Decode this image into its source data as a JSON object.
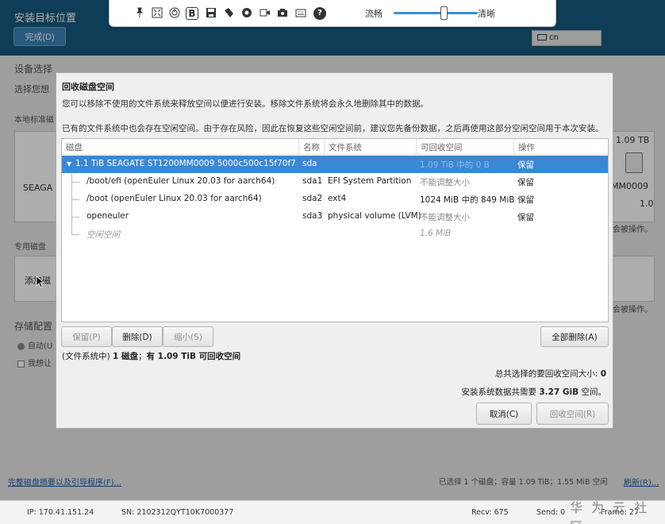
{
  "background": {
    "header_title": "安装目标位置",
    "done_button": "完成(D)",
    "keyboard_layout": "cn",
    "device_selection": "设备选择",
    "device_selection_desc": "选择您想",
    "local_disks": "本地标准磁",
    "disk_name_left": "SEAGA",
    "disk_size_right": "1.09 TB",
    "disk_model_right": "MM0009",
    "disk_num_right": "1.0",
    "not_touched": "会被操作。",
    "special_disks": "专用磁盘",
    "add_disk": "添加磁",
    "storage_config": "存储配置",
    "auto_option": "自动(U",
    "custom_option": "我想让",
    "footer_link": "完整磁盘摘要以及引导程序(F)...",
    "footer_status": "已选择 1 个磁盘；容量 1.09 TiB；1.55 MiB 空闲",
    "refresh_link": "刷新(R)..."
  },
  "toolbar": {
    "label_smooth": "流畅",
    "label_clear": "清晰",
    "quality_value": 0.6
  },
  "dialog": {
    "title": "回收磁盘空间",
    "intro": "您可以移除不使用的文件系统来释放空间以便进行安装。移除文件系统将会永久地删除其中的数据。",
    "warning": "已有的文件系统中也会存在空闲空间。由于存在风险，因此在恢复这些空闲空间前，建议您先备份数据，之后再使用这部分空闲空间用于本次安装。",
    "columns": [
      "磁盘",
      "名称",
      "文件系统",
      "可回收空间",
      "操作"
    ],
    "rows": [
      {
        "disk": "1.1 TiB SEAGATE ST1200MM0009 5000c500c15f70f7",
        "name": "sda",
        "fs": "",
        "reclaimable": "1.09 TiB 中的 0 B",
        "action": "保留"
      },
      {
        "disk": "/boot/efi (openEuler Linux 20.03 for aarch64)",
        "name": "sda1",
        "fs": "EFI System Partition",
        "reclaimable": "不能调整大小",
        "action": "保留"
      },
      {
        "disk": "/boot (openEuler Linux 20.03 for aarch64)",
        "name": "sda2",
        "fs": "ext4",
        "reclaimable": "1024 MiB 中的 849 MiB",
        "action": "保留"
      },
      {
        "disk": "openeuler",
        "name": "sda3",
        "fs": "physical volume (LVM)",
        "reclaimable": "不能调整大小",
        "action": "保留"
      },
      {
        "disk": "空闲空间",
        "name": "",
        "fs": "",
        "reclaimable": "1.6 MiB",
        "action": ""
      }
    ],
    "btn_keep": "保留(P)",
    "btn_delete": "删除(D)",
    "btn_shrink": "缩小(S)",
    "btn_delete_all": "全部删除(A)",
    "summary": "(文件系统中) 1 磁盘；有 1.09 TiB 可回收空间",
    "total_selected": "总共选择的要回收空间大小: 0",
    "install_needs": "安装系统数据共需要 3.27 GiB 空间。",
    "btn_cancel": "取消(C)",
    "btn_reclaim": "回收空间(R)"
  },
  "status_bar": {
    "ip": "IP: 170.41.151.24",
    "sn": "SN: 2102312QYT10K7000377",
    "recv": "Recv: 675",
    "send": "Send: 0",
    "frame": "Frame: 27"
  },
  "watermark": "华 为 云 社 区",
  "icons": [
    "pin-icon",
    "fit-screen-icon",
    "power-icon",
    "b-icon",
    "floppy-icon",
    "mouse-icon",
    "record-icon",
    "video-icon",
    "camera-icon",
    "keyboard-icon",
    "help-icon"
  ]
}
